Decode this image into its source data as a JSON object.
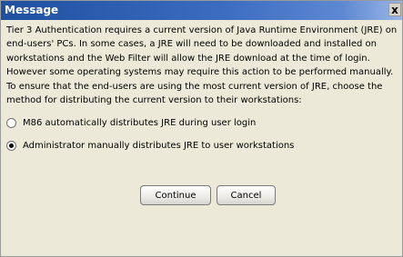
{
  "window": {
    "title": "Message",
    "close_glyph": "x"
  },
  "message": {
    "paragraph1": "Tier 3 Authentication requires a current version of Java Runtime Environment (JRE) on end-users' PCs.  In some cases, a JRE will need to be downloaded and installed on workstations and the Web Filter will allow the JRE download at the time of login. However some operating systems may require this action to be performed manually.",
    "paragraph2": "To ensure that the end-users are using the most current version of JRE, choose the method for distributing the current version to their workstations:"
  },
  "options": [
    {
      "label": "M86 automatically distributes JRE during user login",
      "selected": false
    },
    {
      "label": "Administrator manually distributes JRE to user workstations",
      "selected": true
    }
  ],
  "buttons": {
    "continue_label": "Continue",
    "cancel_label": "Cancel"
  }
}
